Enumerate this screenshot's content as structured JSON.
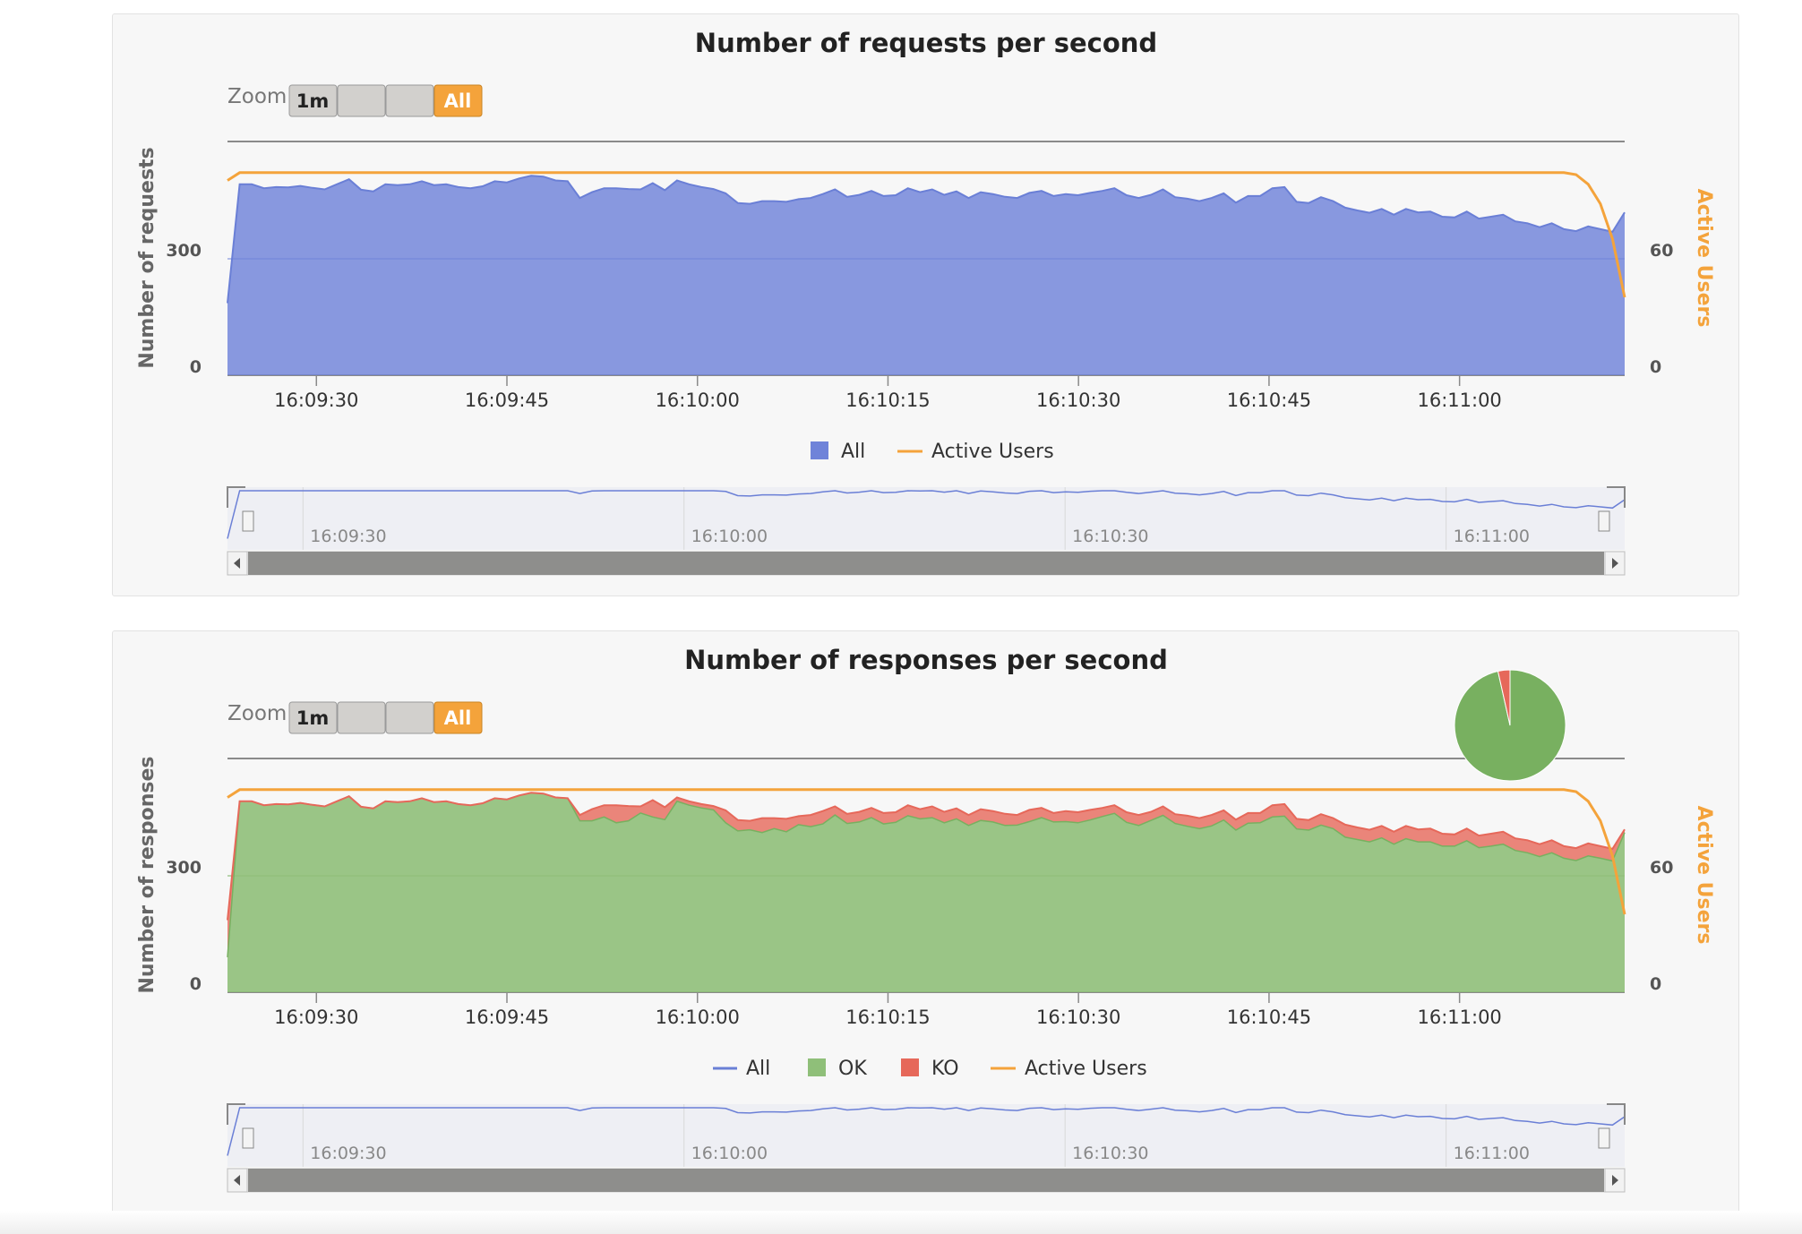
{
  "colors": {
    "all": "#6f83d9",
    "all_line": "#6a7fd6",
    "ok": "#8fbf79",
    "ok_stroke": "#78b060",
    "ko": "#e6685a",
    "users": "#f4a33b",
    "grid": "#8a8a8a"
  },
  "zoom": {
    "label": "Zoom",
    "buttons": [
      "1m",
      "",
      "",
      "All"
    ],
    "selected": "All"
  },
  "chart_data": [
    {
      "type": "area",
      "title": "Number of requests per second",
      "ylabel": "Number of requests",
      "y2label": "Active Users",
      "yticks": [
        0,
        300
      ],
      "y2ticks": [
        0,
        60
      ],
      "ylim": [
        0,
        600
      ],
      "y2lim": [
        0,
        120
      ],
      "xticks": [
        "16:09:30",
        "16:09:45",
        "16:10:00",
        "16:10:15",
        "16:10:30",
        "16:10:45",
        "16:11:00"
      ],
      "xrange_seconds": [
        23,
        133
      ],
      "navigator_ticks": [
        "16:09:30",
        "16:10:00",
        "16:10:30",
        "16:11:00"
      ],
      "legend": [
        {
          "name": "All",
          "kind": "box"
        },
        {
          "name": "Active Users",
          "kind": "line"
        }
      ],
      "series": [
        {
          "name": "All",
          "values": [
            185,
            490,
            490,
            480,
            483,
            482,
            486,
            481,
            477,
            490,
            503,
            476,
            472,
            490,
            488,
            490,
            498,
            488,
            490,
            483,
            480,
            485,
            498,
            495,
            505,
            512,
            510,
            500,
            498,
            455,
            470,
            480,
            480,
            478,
            477,
            493,
            475,
            500,
            490,
            483,
            478,
            467,
            442,
            440,
            447,
            447,
            445,
            452,
            455,
            465,
            477,
            458,
            463,
            473,
            460,
            462,
            480,
            470,
            477,
            463,
            472,
            455,
            470,
            465,
            458,
            455,
            468,
            473,
            460,
            465,
            462,
            468,
            473,
            480,
            462,
            455,
            463,
            477,
            457,
            453,
            447,
            455,
            467,
            443,
            460,
            460,
            480,
            483,
            445,
            442,
            457,
            447,
            430,
            423,
            417,
            427,
            412,
            427,
            418,
            420,
            407,
            405,
            420,
            402,
            407,
            412,
            395,
            390,
            380,
            390,
            375,
            370,
            382,
            375,
            368,
            418
          ]
        },
        {
          "name": "Active Users",
          "values": [
            100,
            104,
            104,
            104,
            104,
            104,
            104,
            104,
            104,
            104,
            104,
            104,
            104,
            104,
            104,
            104,
            104,
            104,
            104,
            104,
            104,
            104,
            104,
            104,
            104,
            104,
            104,
            104,
            104,
            104,
            104,
            104,
            104,
            104,
            104,
            104,
            104,
            104,
            104,
            104,
            104,
            104,
            104,
            104,
            104,
            104,
            104,
            104,
            104,
            104,
            104,
            104,
            104,
            104,
            104,
            104,
            104,
            104,
            104,
            104,
            104,
            104,
            104,
            104,
            104,
            104,
            104,
            104,
            104,
            104,
            104,
            104,
            104,
            104,
            104,
            104,
            104,
            104,
            104,
            104,
            104,
            104,
            104,
            104,
            104,
            104,
            104,
            104,
            104,
            104,
            104,
            104,
            104,
            104,
            104,
            104,
            104,
            104,
            104,
            104,
            104,
            104,
            104,
            104,
            104,
            104,
            104,
            104,
            104,
            104,
            104,
            103,
            98,
            88,
            70,
            40
          ]
        }
      ]
    },
    {
      "type": "area",
      "title": "Number of responses per second",
      "ylabel": "Number of responses",
      "y2label": "Active Users",
      "yticks": [
        0,
        300
      ],
      "y2ticks": [
        0,
        60
      ],
      "ylim": [
        0,
        600
      ],
      "y2lim": [
        0,
        120
      ],
      "xticks": [
        "16:09:30",
        "16:09:45",
        "16:10:00",
        "16:10:15",
        "16:10:30",
        "16:10:45",
        "16:11:00"
      ],
      "xrange_seconds": [
        23,
        133
      ],
      "navigator_ticks": [
        "16:09:30",
        "16:10:00",
        "16:10:30",
        "16:11:00"
      ],
      "legend": [
        {
          "name": "All",
          "kind": "line"
        },
        {
          "name": "OK",
          "kind": "box"
        },
        {
          "name": "KO",
          "kind": "box"
        },
        {
          "name": "Active Users",
          "kind": "line"
        }
      ],
      "series": [
        {
          "name": "All",
          "values": [
            185,
            490,
            490,
            480,
            483,
            482,
            486,
            481,
            477,
            490,
            503,
            476,
            472,
            490,
            488,
            490,
            498,
            488,
            490,
            483,
            480,
            485,
            498,
            495,
            505,
            512,
            510,
            500,
            498,
            455,
            470,
            480,
            480,
            478,
            477,
            493,
            475,
            500,
            490,
            483,
            478,
            467,
            442,
            440,
            447,
            447,
            445,
            452,
            455,
            465,
            477,
            458,
            463,
            473,
            460,
            462,
            480,
            470,
            477,
            463,
            472,
            455,
            470,
            465,
            458,
            455,
            468,
            473,
            460,
            465,
            462,
            468,
            473,
            480,
            462,
            455,
            463,
            477,
            457,
            453,
            447,
            455,
            467,
            443,
            460,
            460,
            480,
            483,
            445,
            442,
            457,
            447,
            430,
            423,
            417,
            427,
            412,
            427,
            418,
            420,
            407,
            405,
            420,
            402,
            407,
            412,
            395,
            390,
            380,
            390,
            375,
            370,
            382,
            375,
            368,
            418
          ]
        },
        {
          "name": "OK",
          "values": [
            90,
            490,
            490,
            480,
            483,
            482,
            486,
            481,
            477,
            490,
            503,
            476,
            472,
            490,
            488,
            490,
            498,
            488,
            490,
            483,
            480,
            485,
            498,
            495,
            505,
            512,
            510,
            500,
            498,
            440,
            440,
            450,
            435,
            440,
            460,
            450,
            443,
            490,
            480,
            473,
            468,
            435,
            414,
            417,
            410,
            420,
            412,
            430,
            425,
            432,
            455,
            433,
            437,
            448,
            432,
            436,
            453,
            445,
            448,
            435,
            445,
            428,
            441,
            437,
            428,
            429,
            438,
            448,
            437,
            438,
            435,
            442,
            451,
            459,
            436,
            428,
            441,
            454,
            433,
            426,
            420,
            427,
            442,
            416,
            434,
            435,
            450,
            452,
            419,
            416,
            429,
            420,
            398,
            392,
            386,
            396,
            380,
            394,
            386,
            386,
            375,
            375,
            389,
            371,
            375,
            380,
            364,
            358,
            348,
            358,
            344,
            338,
            350,
            344,
            337,
            410
          ]
        },
        {
          "name": "Active Users",
          "values": [
            100,
            104,
            104,
            104,
            104,
            104,
            104,
            104,
            104,
            104,
            104,
            104,
            104,
            104,
            104,
            104,
            104,
            104,
            104,
            104,
            104,
            104,
            104,
            104,
            104,
            104,
            104,
            104,
            104,
            104,
            104,
            104,
            104,
            104,
            104,
            104,
            104,
            104,
            104,
            104,
            104,
            104,
            104,
            104,
            104,
            104,
            104,
            104,
            104,
            104,
            104,
            104,
            104,
            104,
            104,
            104,
            104,
            104,
            104,
            104,
            104,
            104,
            104,
            104,
            104,
            104,
            104,
            104,
            104,
            104,
            104,
            104,
            104,
            104,
            104,
            104,
            104,
            104,
            104,
            104,
            104,
            104,
            104,
            104,
            104,
            104,
            104,
            104,
            104,
            104,
            104,
            104,
            104,
            104,
            104,
            104,
            104,
            104,
            104,
            104,
            104,
            104,
            104,
            104,
            104,
            104,
            104,
            104,
            104,
            104,
            104,
            103,
            98,
            88,
            70,
            40
          ]
        }
      ],
      "pie": {
        "slices": [
          {
            "name": "OK",
            "value": 96.5
          },
          {
            "name": "KO",
            "value": 3.5
          }
        ]
      }
    }
  ]
}
